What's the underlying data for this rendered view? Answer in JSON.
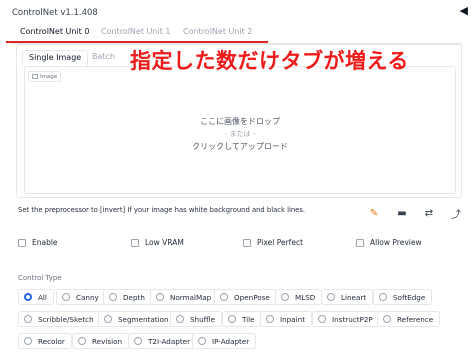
{
  "header": {
    "title": "ControlNet v1.1.408",
    "collapse_icon": "◀"
  },
  "tabs": [
    {
      "label": "ControlNet Unit 0",
      "active": true
    },
    {
      "label": "ControlNet Unit 1",
      "active": false
    },
    {
      "label": "ControlNet Unit 2",
      "active": false
    }
  ],
  "overlay_text": "指定した数だけタブが増える",
  "subtabs": [
    {
      "label": "Single Image",
      "active": true
    },
    {
      "label": "Batch",
      "active": false
    }
  ],
  "dropzone": {
    "image_label": "Image",
    "line1": "ここに画像をドロップ",
    "line2": "- または -",
    "line3": "クリックしてアップロード"
  },
  "hint": "Set the preprocessor to [invert] If your image has white background and black lines.",
  "tools": [
    {
      "name": "pencil-icon",
      "glyph": "✎"
    },
    {
      "name": "camera-icon",
      "glyph": "▬"
    },
    {
      "name": "swap-icon",
      "glyph": "⇄"
    },
    {
      "name": "send-icon",
      "glyph": "⤴"
    }
  ],
  "checkboxes": [
    {
      "label": "Enable",
      "checked": false
    },
    {
      "label": "Low VRAM",
      "checked": false
    },
    {
      "label": "Pixel Perfect",
      "checked": false
    },
    {
      "label": "Allow Preview",
      "checked": false
    }
  ],
  "control_type": {
    "label": "Control Type",
    "selected": "All",
    "options": [
      "All",
      "Canny",
      "Depth",
      "NormalMap",
      "OpenPose",
      "MLSD",
      "Lineart",
      "SoftEdge",
      "Scribble/Sketch",
      "Segmentation",
      "Shuffle",
      "Tile",
      "Inpaint",
      "InstructP2P",
      "Reference",
      "Recolor",
      "Revision",
      "T2I-Adapter",
      "IP-Adapter"
    ]
  },
  "colors": {
    "accent_red": "#dc2626",
    "radio_selected": "#2563eb",
    "overlay_red": "#ef1b1b"
  }
}
